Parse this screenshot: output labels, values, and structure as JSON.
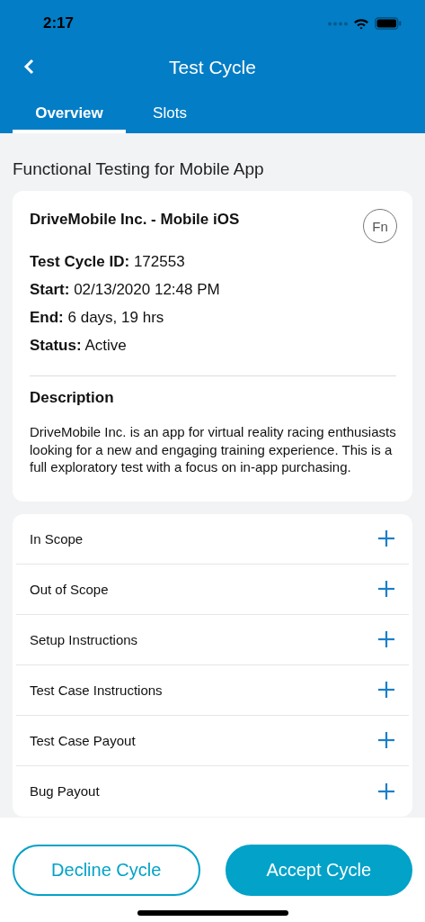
{
  "status_bar": {
    "time": "2:17"
  },
  "header": {
    "title": "Test Cycle"
  },
  "tabs": [
    {
      "label": "Overview",
      "selected": true
    },
    {
      "label": "Slots",
      "selected": false
    }
  ],
  "section_title": "Functional Testing for Mobile App",
  "summary": {
    "product": "DriveMobile Inc. - Mobile iOS",
    "badge": "Fn",
    "details": [
      {
        "label": "Test Cycle ID:",
        "value": "172553"
      },
      {
        "label": "Start:",
        "value": "02/13/2020 12:48 PM"
      },
      {
        "label": "End:",
        "value": "6 days, 19 hrs"
      },
      {
        "label": "Status:",
        "value": "Active"
      }
    ],
    "description_heading": "Description",
    "description": "DriveMobile Inc. is an app for virtual reality racing enthusiasts looking for a new and engaging training experience. This is a full exploratory test with a focus on in-app purchasing."
  },
  "sections": [
    {
      "label": "In Scope",
      "expanded": false
    },
    {
      "label": "Out of Scope",
      "expanded": false
    },
    {
      "label": "Setup Instructions",
      "expanded": false
    },
    {
      "label": "Test Case Instructions",
      "expanded": false
    },
    {
      "label": "Test Case Payout",
      "expanded": false
    },
    {
      "label": "Bug Payout",
      "expanded": false
    }
  ],
  "actions": [
    {
      "label": "Decline Cycle",
      "kind": "secondary"
    },
    {
      "label": "Accept Cycle",
      "kind": "primary"
    }
  ]
}
